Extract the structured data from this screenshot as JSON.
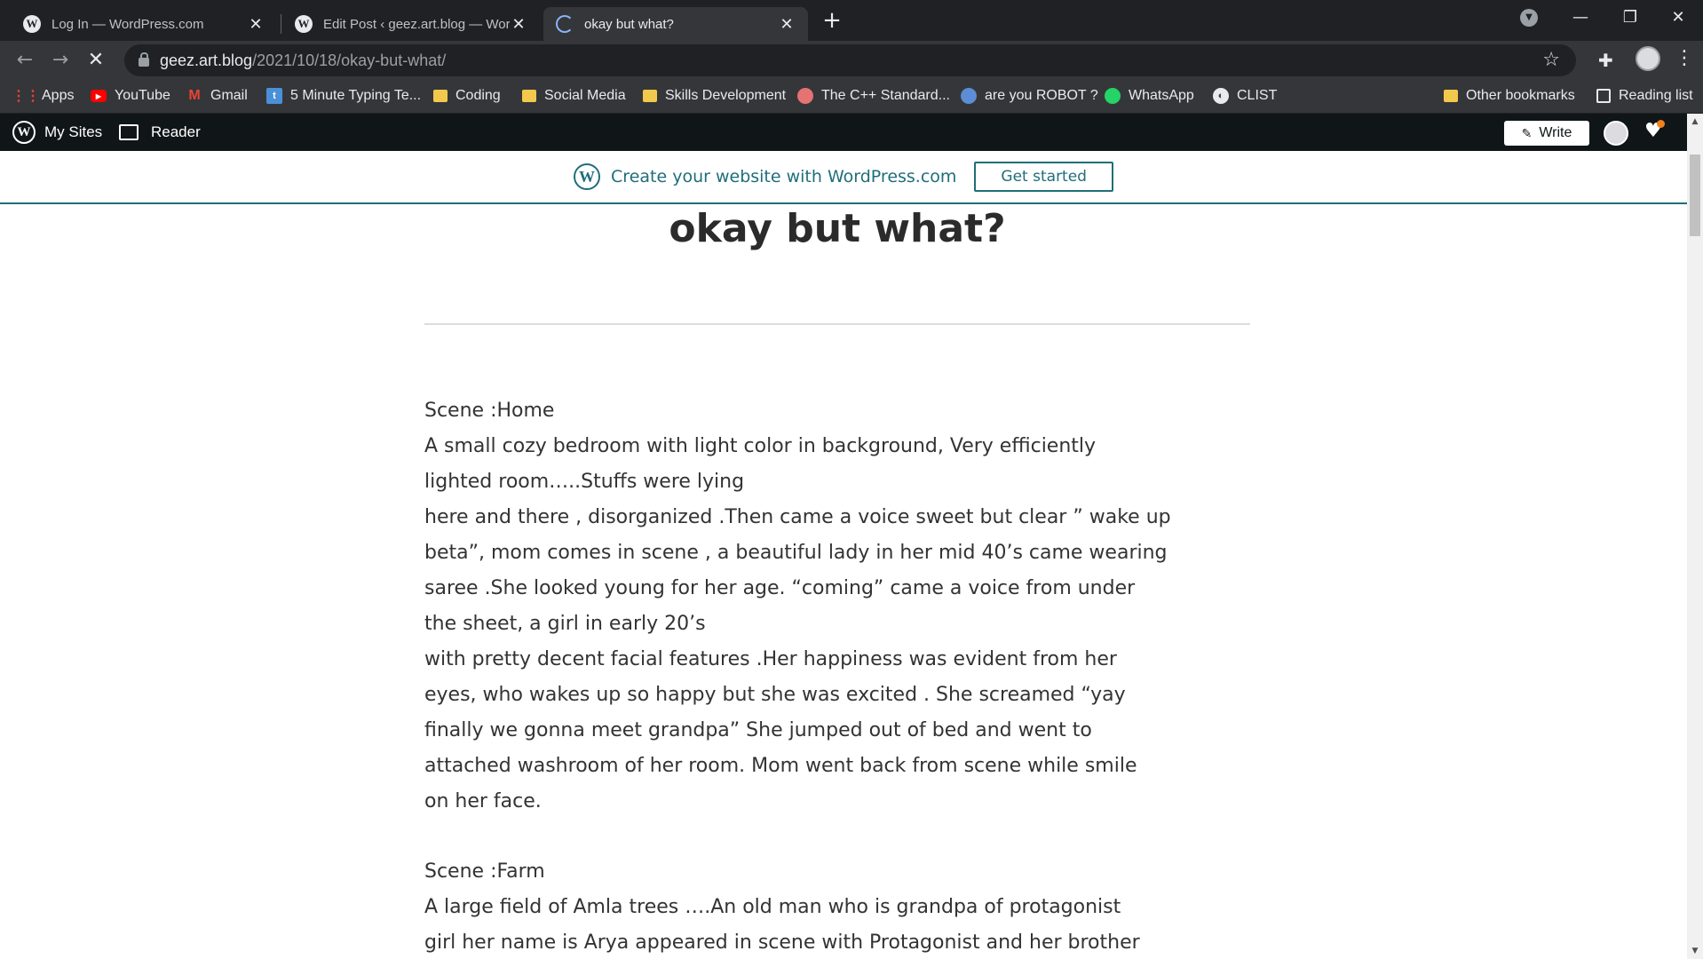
{
  "browser": {
    "tabs": [
      {
        "title": "Log In — WordPress.com",
        "icon": "wordpress-icon"
      },
      {
        "title": "Edit Post ‹ geez.art.blog — WordPress.com",
        "icon": "wordpress-icon"
      },
      {
        "title": "okay but what?",
        "icon": "loading-spinner-icon"
      }
    ],
    "url_host": "geez.art.blog",
    "url_path": "/2021/10/18/okay-but-what/",
    "bookmarks": [
      {
        "label": "Apps",
        "icon": "apps-grid-icon"
      },
      {
        "label": "YouTube",
        "icon": "youtube-icon"
      },
      {
        "label": "Gmail",
        "icon": "gmail-icon"
      },
      {
        "label": "5 Minute Typing Te...",
        "icon": "typing-site-icon"
      },
      {
        "label": "Coding",
        "icon": "folder-icon"
      },
      {
        "label": "Social Media",
        "icon": "folder-icon"
      },
      {
        "label": "Skills Development",
        "icon": "folder-icon"
      },
      {
        "label": "The C++ Standard...",
        "icon": "cpp-site-icon"
      },
      {
        "label": "are you ROBOT ?",
        "icon": "robot-site-icon"
      },
      {
        "label": "WhatsApp",
        "icon": "whatsapp-icon"
      },
      {
        "label": "CLIST",
        "icon": "clist-icon"
      }
    ],
    "other_bookmarks": "Other bookmarks",
    "reading_list": "Reading list"
  },
  "wp_admin_bar": {
    "my_sites": "My Sites",
    "reader": "Reader",
    "write": "Write"
  },
  "banner": {
    "text": "Create your website with WordPress.com",
    "button": "Get started"
  },
  "post": {
    "title": "okay but what?",
    "paragraphs": [
      {
        "lines": [
          "Scene :Home",
          "A small cozy bedroom with light color in background, Very efficiently",
          "lighted room…..Stuffs were lying",
          "here and there , disorganized .Then came a voice sweet but clear ” wake up",
          "beta”, mom comes in scene , a beautiful lady in her mid 40’s came wearing",
          "saree .She looked young for her age. “coming” came a voice from under",
          "the sheet, a girl in early 20’s",
          "with pretty decent facial features .Her happiness was evident from her",
          "eyes, who wakes up so happy but she was excited . She screamed “yay",
          "finally we gonna meet grandpa” She jumped out of bed and went to",
          "attached washroom of her room. Mom went back from scene while smile",
          "on her face."
        ]
      },
      {
        "lines": [
          "Scene :Farm",
          "A large field of Amla trees ….An old man who is grandpa of protagonist",
          "girl her name is Arya appeared in scene with Protagonist and her brother"
        ]
      }
    ]
  },
  "colors": {
    "chrome_dark": "#202124",
    "chrome_toolbar": "#35363a",
    "wp_bar": "#101517",
    "banner_accent": "#1f6e7a",
    "text": "#333333"
  }
}
